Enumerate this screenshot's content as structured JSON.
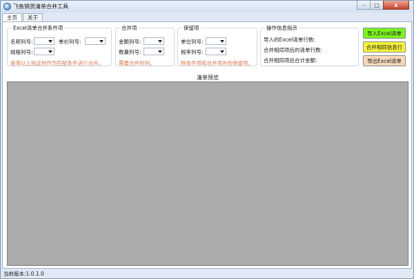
{
  "window": {
    "title": "飞鱼销货清单合并工具",
    "minimize_glyph": "–",
    "maximize_glyph": "□",
    "close_glyph": "x"
  },
  "tabs": [
    {
      "label": "主页"
    },
    {
      "label": "关于"
    }
  ],
  "excel_conditions": {
    "title": "Excel清单合并条件项",
    "name_col_label": "名称列号:",
    "price_col_label": "单价列号:",
    "spec_col_label": "规格列号:",
    "hint": "使用以上指定列作为匹配条件进行合并。"
  },
  "merge_items": {
    "title": "合并项",
    "amount_col_label": "金额列号:",
    "qty_col_label": "数量列号:",
    "hint": "需要合并的列。"
  },
  "keep_items": {
    "title": "保留项",
    "unit_col_label": "单位列号:",
    "tax_col_label": "税率列号:",
    "hint": "除条件项和合并项外的保留项。"
  },
  "op_info": {
    "title": "操作信息指示",
    "imported_rows_label": "导入的Excel清单行数:",
    "merged_rows_label": "合并相同项后的清单行数:",
    "merged_total_label": "合并相同项后合计金额:"
  },
  "buttons": {
    "import_label": "导入Excel清单",
    "merge_label": "合并相同信息行",
    "export_label": "导出Excel清单"
  },
  "colors": {
    "import_button": "#7cf220",
    "merge_button": "#f5f23a",
    "export_button": "#f7d9b9",
    "hint_text": "#d9734e",
    "preview_background": "#ababab"
  },
  "preview": {
    "title": "清单预览"
  },
  "status": {
    "version_text": "当前版本:1.0.1.0"
  }
}
